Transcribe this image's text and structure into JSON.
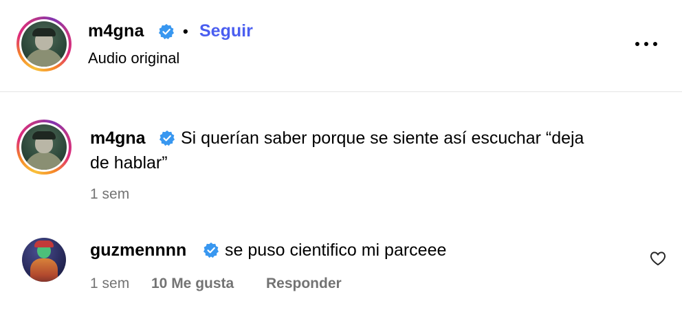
{
  "header": {
    "username": "m4gna",
    "separator": "•",
    "follow_label": "Seguir",
    "subtitle": "Audio original",
    "more_icon": "more-horizontal-icon"
  },
  "caption": {
    "username": "m4gna",
    "text_line1": "Si querían saber porque se siente así escuchar “deja",
    "text_line2": "de hablar”",
    "time": "1 sem"
  },
  "comment": {
    "username": "guzmennnn",
    "text": "se puso cientifico mi parceee",
    "time": "1 sem",
    "likes": "10 Me gusta",
    "reply_label": "Responder",
    "like_icon": "heart-icon"
  },
  "colors": {
    "accent": "#4a5ef0",
    "verified": "#3897f0",
    "meta": "#737373",
    "divider": "#e4e4e4"
  }
}
